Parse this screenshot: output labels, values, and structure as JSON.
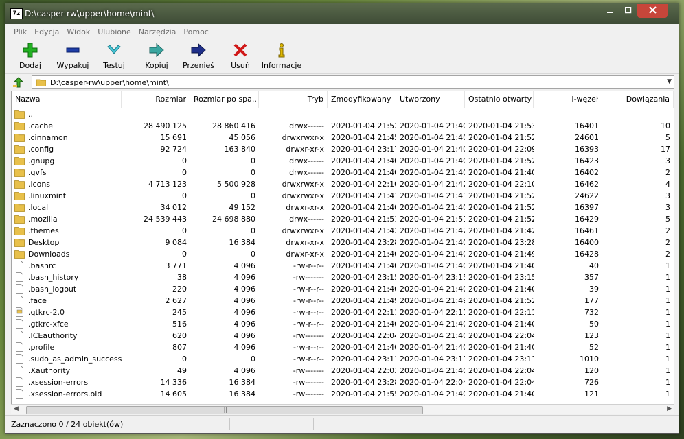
{
  "window": {
    "title": "D:\\casper-rw\\upper\\home\\mint\\",
    "app_icon_text": "7z"
  },
  "menu": [
    "Plik",
    "Edycja",
    "Widok",
    "Ulubione",
    "Narzędzia",
    "Pomoc"
  ],
  "toolbar": {
    "add": "Dodaj",
    "extract": "Wypakuj",
    "test": "Testuj",
    "copy": "Kopiuj",
    "move": "Przenieś",
    "delete": "Usuń",
    "info": "Informacje"
  },
  "address": {
    "path": "D:\\casper-rw\\upper\\home\\mint\\"
  },
  "columns": {
    "name": "Nazwa",
    "size": "Rozmiar",
    "packed": "Rozmiar po spa...",
    "attributes": "Tryb",
    "modified": "Zmodyfikowany",
    "created": "Utworzony",
    "accessed": "Ostatnio otwarty",
    "inode": "I-węzeł",
    "links": "Dowiązania"
  },
  "rows": [
    {
      "icon": "parent-folder",
      "name": "..",
      "size": "",
      "packed": "",
      "attr": "",
      "mod": "",
      "created": "",
      "access": "",
      "inode": "",
      "links": ""
    },
    {
      "icon": "folder",
      "name": ".cache",
      "size": "28 490 125",
      "packed": "28 860 416",
      "attr": "drwx------",
      "mod": "2020-01-04 21:52",
      "created": "2020-01-04 21:40",
      "access": "2020-01-04 21:53",
      "inode": "16401",
      "links": "10"
    },
    {
      "icon": "folder",
      "name": ".cinnamon",
      "size": "15 691",
      "packed": "45 056",
      "attr": "drwxrwxr-x",
      "mod": "2020-01-04 21:45",
      "created": "2020-01-04 21:40",
      "access": "2020-01-04 21:52",
      "inode": "24601",
      "links": "5"
    },
    {
      "icon": "folder",
      "name": ".config",
      "size": "92 724",
      "packed": "163 840",
      "attr": "drwxr-xr-x",
      "mod": "2020-01-04 23:17",
      "created": "2020-01-04 21:40",
      "access": "2020-01-04 22:09",
      "inode": "16393",
      "links": "17"
    },
    {
      "icon": "folder",
      "name": ".gnupg",
      "size": "0",
      "packed": "0",
      "attr": "drwx------",
      "mod": "2020-01-04 21:40",
      "created": "2020-01-04 21:40",
      "access": "2020-01-04 21:52",
      "inode": "16423",
      "links": "3"
    },
    {
      "icon": "folder",
      "name": ".gvfs",
      "size": "0",
      "packed": "0",
      "attr": "drwx------",
      "mod": "2020-01-04 21:40",
      "created": "2020-01-04 21:40",
      "access": "2020-01-04 21:40",
      "inode": "16402",
      "links": "2"
    },
    {
      "icon": "folder",
      "name": ".icons",
      "size": "4 713 123",
      "packed": "5 500 928",
      "attr": "drwxrwxr-x",
      "mod": "2020-01-04 22:10",
      "created": "2020-01-04 21:42",
      "access": "2020-01-04 22:10",
      "inode": "16462",
      "links": "4"
    },
    {
      "icon": "folder",
      "name": ".linuxmint",
      "size": "0",
      "packed": "0",
      "attr": "drwxrwxr-x",
      "mod": "2020-01-04 21:41",
      "created": "2020-01-04 21:41",
      "access": "2020-01-04 21:52",
      "inode": "24622",
      "links": "3"
    },
    {
      "icon": "folder",
      "name": ".local",
      "size": "34 012",
      "packed": "49 152",
      "attr": "drwxr-xr-x",
      "mod": "2020-01-04 21:40",
      "created": "2020-01-04 21:40",
      "access": "2020-01-04 21:52",
      "inode": "16397",
      "links": "3"
    },
    {
      "icon": "folder",
      "name": ".mozilla",
      "size": "24 539 443",
      "packed": "24 698 880",
      "attr": "drwx------",
      "mod": "2020-01-04 21:51",
      "created": "2020-01-04 21:51",
      "access": "2020-01-04 21:52",
      "inode": "16429",
      "links": "5"
    },
    {
      "icon": "folder",
      "name": ".themes",
      "size": "0",
      "packed": "0",
      "attr": "drwxrwxr-x",
      "mod": "2020-01-04 21:42",
      "created": "2020-01-04 21:42",
      "access": "2020-01-04 21:42",
      "inode": "16461",
      "links": "2"
    },
    {
      "icon": "folder",
      "name": "Desktop",
      "size": "9 084",
      "packed": "16 384",
      "attr": "drwxr-xr-x",
      "mod": "2020-01-04 23:28",
      "created": "2020-01-04 21:40",
      "access": "2020-01-04 23:28",
      "inode": "16400",
      "links": "2"
    },
    {
      "icon": "folder",
      "name": "Downloads",
      "size": "0",
      "packed": "0",
      "attr": "drwxr-xr-x",
      "mod": "2020-01-04 21:40",
      "created": "2020-01-04 21:40",
      "access": "2020-01-04 21:49",
      "inode": "16428",
      "links": "2"
    },
    {
      "icon": "file",
      "name": ".bashrc",
      "size": "3 771",
      "packed": "4 096",
      "attr": "-rw-r--r--",
      "mod": "2020-01-04 21:40",
      "created": "2020-01-04 21:40",
      "access": "2020-01-04 21:40",
      "inode": "40",
      "links": "1"
    },
    {
      "icon": "file",
      "name": ".bash_history",
      "size": "38",
      "packed": "4 096",
      "attr": "-rw-------",
      "mod": "2020-01-04 23:15",
      "created": "2020-01-04 23:15",
      "access": "2020-01-04 23:15",
      "inode": "357",
      "links": "1"
    },
    {
      "icon": "file",
      "name": ".bash_logout",
      "size": "220",
      "packed": "4 096",
      "attr": "-rw-r--r--",
      "mod": "2020-01-04 21:40",
      "created": "2020-01-04 21:40",
      "access": "2020-01-04 21:40",
      "inode": "39",
      "links": "1"
    },
    {
      "icon": "file",
      "name": ".face",
      "size": "2 627",
      "packed": "4 096",
      "attr": "-rw-r--r--",
      "mod": "2020-01-04 21:49",
      "created": "2020-01-04 21:49",
      "access": "2020-01-04 21:52",
      "inode": "177",
      "links": "1"
    },
    {
      "icon": "config-file",
      "name": ".gtkrc-2.0",
      "size": "245",
      "packed": "4 096",
      "attr": "-rw-r--r--",
      "mod": "2020-01-04 22:11",
      "created": "2020-01-04 22:11",
      "access": "2020-01-04 22:11",
      "inode": "732",
      "links": "1"
    },
    {
      "icon": "file",
      "name": ".gtkrc-xfce",
      "size": "516",
      "packed": "4 096",
      "attr": "-rw-r--r--",
      "mod": "2020-01-04 21:40",
      "created": "2020-01-04 21:40",
      "access": "2020-01-04 21:40",
      "inode": "50",
      "links": "1"
    },
    {
      "icon": "file",
      "name": ".ICEauthority",
      "size": "620",
      "packed": "4 096",
      "attr": "-rw-------",
      "mod": "2020-01-04 22:04",
      "created": "2020-01-04 21:40",
      "access": "2020-01-04 22:04",
      "inode": "123",
      "links": "1"
    },
    {
      "icon": "file",
      "name": ".profile",
      "size": "807",
      "packed": "4 096",
      "attr": "-rw-r--r--",
      "mod": "2020-01-04 21:40",
      "created": "2020-01-04 21:40",
      "access": "2020-01-04 21:40",
      "inode": "52",
      "links": "1"
    },
    {
      "icon": "file",
      "name": ".sudo_as_admin_success...",
      "size": "0",
      "packed": "0",
      "attr": "-rw-r--r--",
      "mod": "2020-01-04 23:11",
      "created": "2020-01-04 23:11",
      "access": "2020-01-04 23:11",
      "inode": "1010",
      "links": "1"
    },
    {
      "icon": "file",
      "name": ".Xauthority",
      "size": "49",
      "packed": "4 096",
      "attr": "-rw-------",
      "mod": "2020-01-04 22:03",
      "created": "2020-01-04 21:40",
      "access": "2020-01-04 22:04",
      "inode": "120",
      "links": "1"
    },
    {
      "icon": "file",
      "name": ".xsession-errors",
      "size": "14 336",
      "packed": "16 384",
      "attr": "-rw-------",
      "mod": "2020-01-04 23:28",
      "created": "2020-01-04 22:04",
      "access": "2020-01-04 22:04",
      "inode": "726",
      "links": "1"
    },
    {
      "icon": "file",
      "name": ".xsession-errors.old",
      "size": "14 605",
      "packed": "16 384",
      "attr": "-rw-------",
      "mod": "2020-01-04 21:55",
      "created": "2020-01-04 21:40",
      "access": "2020-01-04 21:40",
      "inode": "121",
      "links": "1"
    }
  ],
  "status": {
    "text": "Zaznaczono 0 / 24 obiekt(ów)"
  },
  "colors": {
    "titlebar": "#4a5a40",
    "close": "#c7463a",
    "folder": "#e8c04a"
  }
}
